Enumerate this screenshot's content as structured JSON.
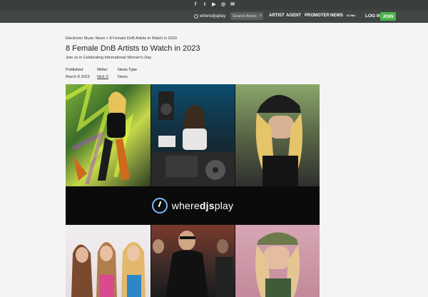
{
  "topbar": {
    "icons": [
      "facebook-icon",
      "twitter-icon",
      "youtube-icon",
      "instagram-icon",
      "email-icon"
    ],
    "glyphs": [
      "f",
      "t",
      "▶",
      "◎",
      "✉"
    ]
  },
  "nav": {
    "logo": "wheredjsplay",
    "search_placeholder": "Search Artists",
    "links": [
      "ARTIST",
      "AGENT",
      "PROMOTER",
      "NEWS"
    ],
    "small": "DJ Mix",
    "login": "LOG IN",
    "join": "JOIN"
  },
  "article": {
    "breadcrumb": "Electronic Music News > 8 Female DnB Artists to Watch in 2023",
    "title": "8 Female DnB Artists to Watch in 2023",
    "subtitle": "Join us in Celebrating International Women's Day",
    "published_label": "Published",
    "published_value": "March 8 2023",
    "writer_label": "Writer",
    "writer_value": "Nick S",
    "newstype_label": "News Type",
    "newstype_value": "News"
  },
  "collage": {
    "banner_text_1": "where",
    "banner_text_2": "djs",
    "banner_text_3": "play"
  }
}
